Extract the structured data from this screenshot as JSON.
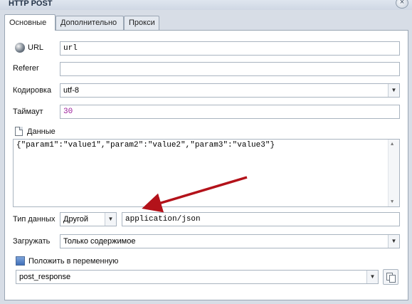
{
  "window": {
    "title": "HTTP POST",
    "close_glyph": "×"
  },
  "tabs": [
    {
      "label": "Основные",
      "active": true
    },
    {
      "label": "Дополнительно",
      "active": false
    },
    {
      "label": "Прокси",
      "active": false
    }
  ],
  "form": {
    "url": {
      "label": "URL",
      "value": "url",
      "icon": "globe-icon"
    },
    "referer": {
      "label": "Referer",
      "value": ""
    },
    "encoding": {
      "label": "Кодировка",
      "value": "utf-8"
    },
    "timeout": {
      "label": "Таймаут",
      "value": "30"
    },
    "data": {
      "label": "Данные",
      "icon": "document-icon",
      "value": "{\"param1\":\"value1\",\"param2\":\"value2\",\"param3\":\"value3\"}"
    },
    "data_type": {
      "label": "Тип данных",
      "selected": "Другой",
      "content_type": "application/json"
    },
    "load": {
      "label": "Загружать",
      "selected": "Только содержимое"
    },
    "save_to_variable": {
      "label": "Положить в переменную",
      "checked": true,
      "value": "post_response"
    }
  },
  "colors": {
    "arrow": "#b3121a",
    "number_text": "#9a1b9a",
    "accent": "#3f6fb8"
  }
}
